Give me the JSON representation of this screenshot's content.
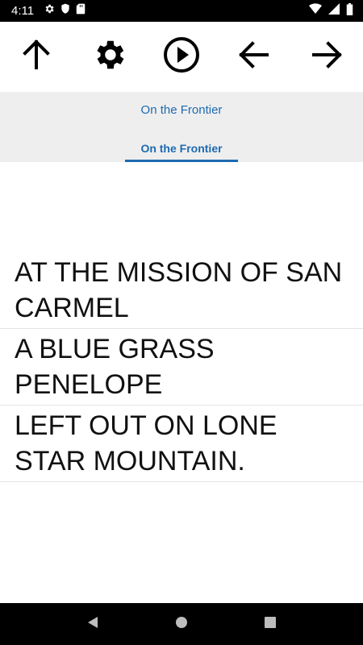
{
  "status": {
    "time": "4:11"
  },
  "icons": {
    "settings_status": "gear-icon",
    "shield": "shield-icon",
    "sdcard": "sdcard-icon",
    "wifi": "wifi-icon",
    "signal": "signal-icon",
    "battery": "battery-icon",
    "up": "arrow-up-icon",
    "settings": "gear-icon",
    "play": "play-icon",
    "back": "arrow-left-icon",
    "forward": "arrow-right-icon",
    "nav_back": "triangle-back-icon",
    "nav_home": "circle-home-icon",
    "nav_recents": "square-recents-icon"
  },
  "colors": {
    "accent": "#1e6ab0",
    "header_bg": "#eeeeee"
  },
  "header": {
    "book_title": "On the Frontier",
    "tab_label": "On the Frontier"
  },
  "chapters": [
    {
      "label": "AT THE MISSION OF SAN CARMEL"
    },
    {
      "label": "A BLUE GRASS PENELOPE"
    },
    {
      "label": "LEFT OUT ON LONE STAR MOUNTAIN."
    }
  ]
}
